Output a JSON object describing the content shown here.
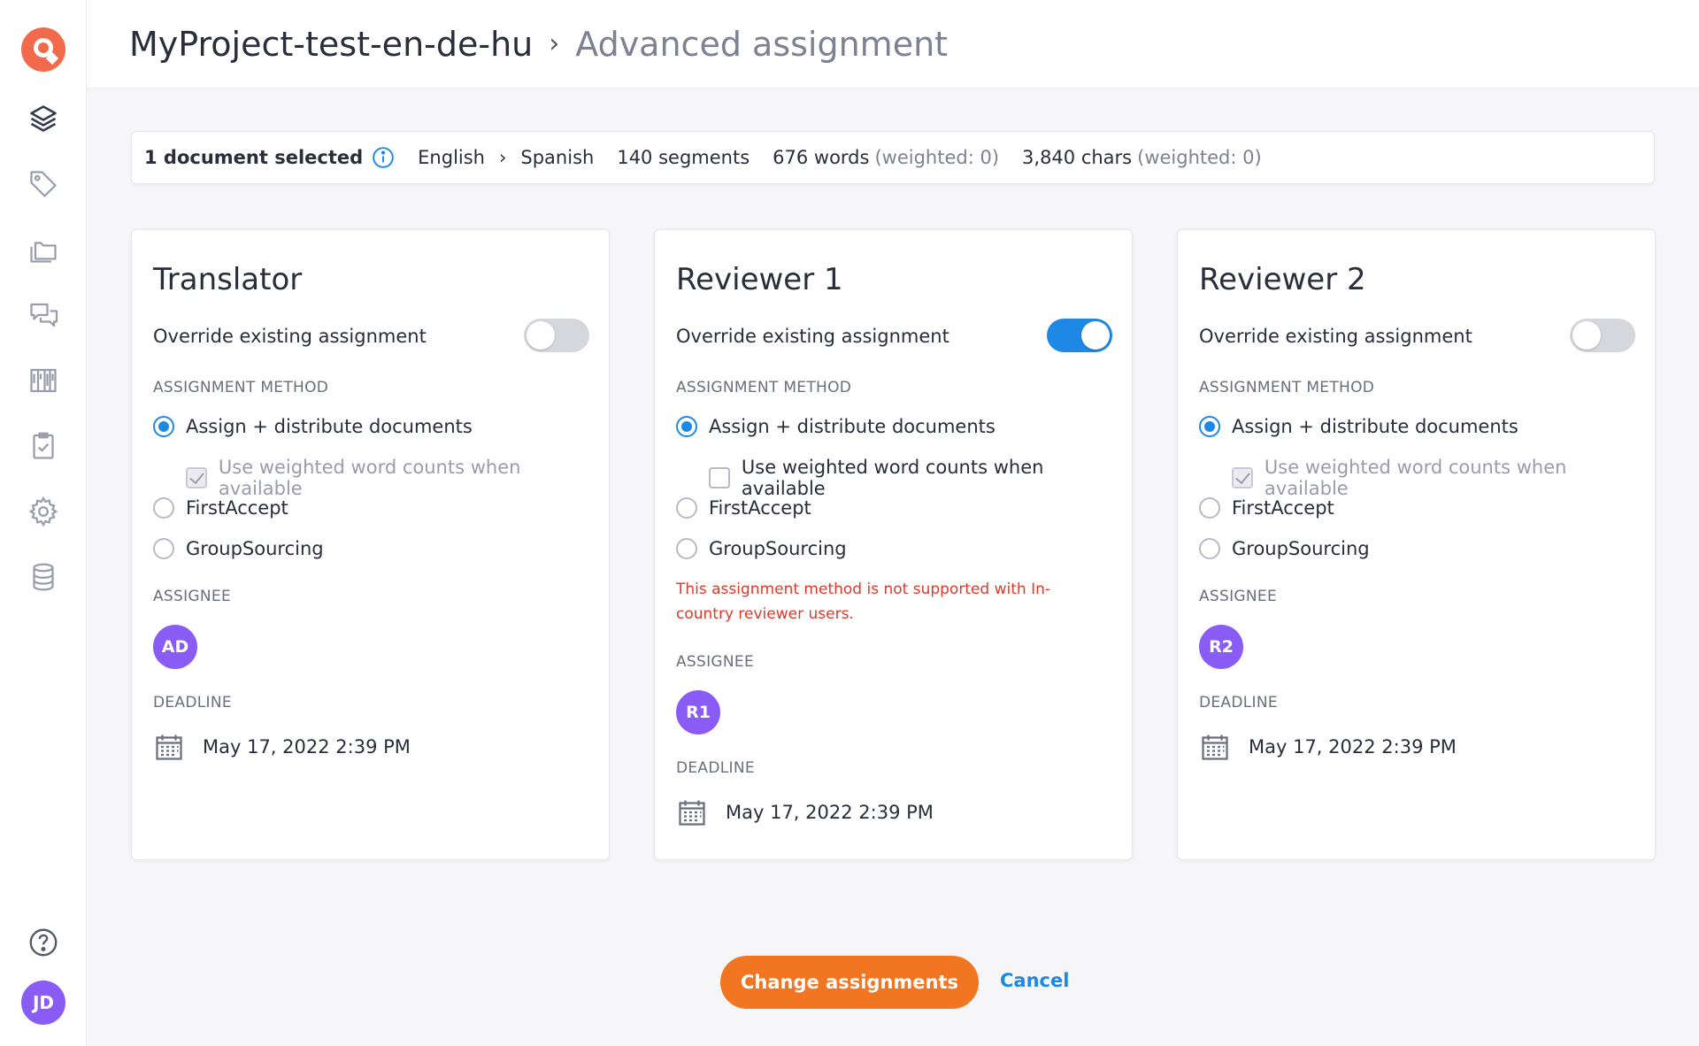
{
  "user": {
    "initials": "JD"
  },
  "breadcrumb": {
    "project": "MyProject-test-en-de-hu",
    "page": "Advanced assignment"
  },
  "summary": {
    "selected": "1 document selected",
    "source_lang": "English",
    "target_lang": "Spanish",
    "segments": "140 segments",
    "words": "676 words",
    "words_weighted": "(weighted: 0)",
    "chars": "3,840 chars",
    "chars_weighted": "(weighted: 0)"
  },
  "labels": {
    "override": "Override existing assignment",
    "assignment_method": "ASSIGNMENT METHOD",
    "assign_distribute": "Assign + distribute documents",
    "weighted": "Use weighted word counts when available",
    "first_accept": "FirstAccept",
    "group_sourcing": "GroupSourcing",
    "assignee": "ASSIGNEE",
    "deadline": "DEADLINE"
  },
  "cards": [
    {
      "title": "Translator",
      "override_on": false,
      "assignee": "AD",
      "deadline": "May 17, 2022 2:39 PM"
    },
    {
      "title": "Reviewer 1",
      "override_on": true,
      "error": "This assignment method is not supported with In-country reviewer users.",
      "assignee": "R1",
      "deadline": "May 17, 2022 2:39 PM"
    },
    {
      "title": "Reviewer 2",
      "override_on": false,
      "assignee": "R2",
      "deadline": "May 17, 2022 2:39 PM"
    }
  ],
  "actions": {
    "primary": "Change assignments",
    "cancel": "Cancel"
  },
  "colors": {
    "accent": "#f27522",
    "link": "#1e88e5",
    "avatar": "#8a5cf6",
    "error": "#e0392b"
  },
  "nav_icons": [
    "layers-icon",
    "tag-icon",
    "folders-icon",
    "chat-icon",
    "columns-icon",
    "clipboard-check-icon",
    "gear-icon",
    "database-icon",
    "help-icon"
  ]
}
